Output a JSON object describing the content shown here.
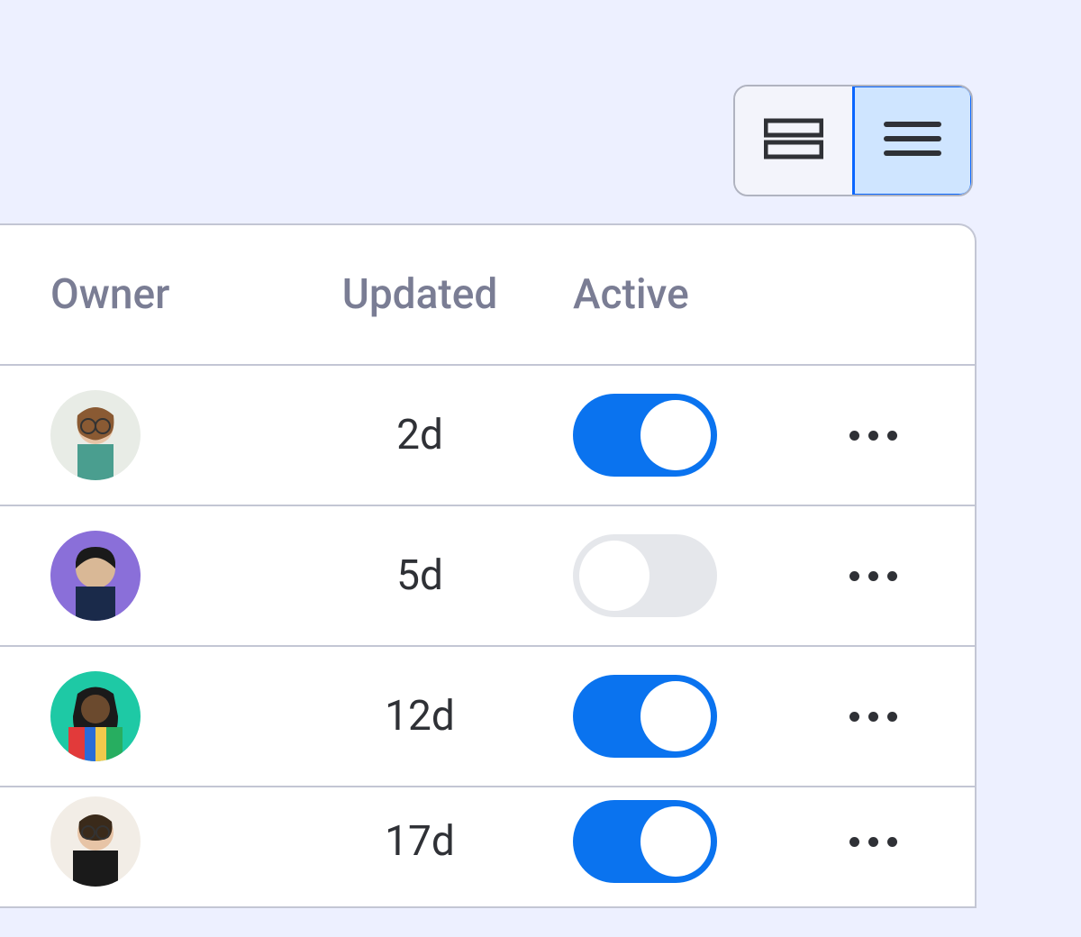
{
  "viewToggle": {
    "options": [
      "rows",
      "list"
    ],
    "active": "list"
  },
  "table": {
    "headers": {
      "owner": "Owner",
      "updated": "Updated",
      "active": "Active"
    },
    "rows": [
      {
        "updated": "2d",
        "active": true
      },
      {
        "updated": "5d",
        "active": false
      },
      {
        "updated": "12d",
        "active": true
      },
      {
        "updated": "17d",
        "active": true
      }
    ]
  },
  "colors": {
    "accent": "#0a73ef",
    "headerText": "#7a7d94",
    "bodyText": "#2f3136",
    "bg": "#edf0ff"
  }
}
